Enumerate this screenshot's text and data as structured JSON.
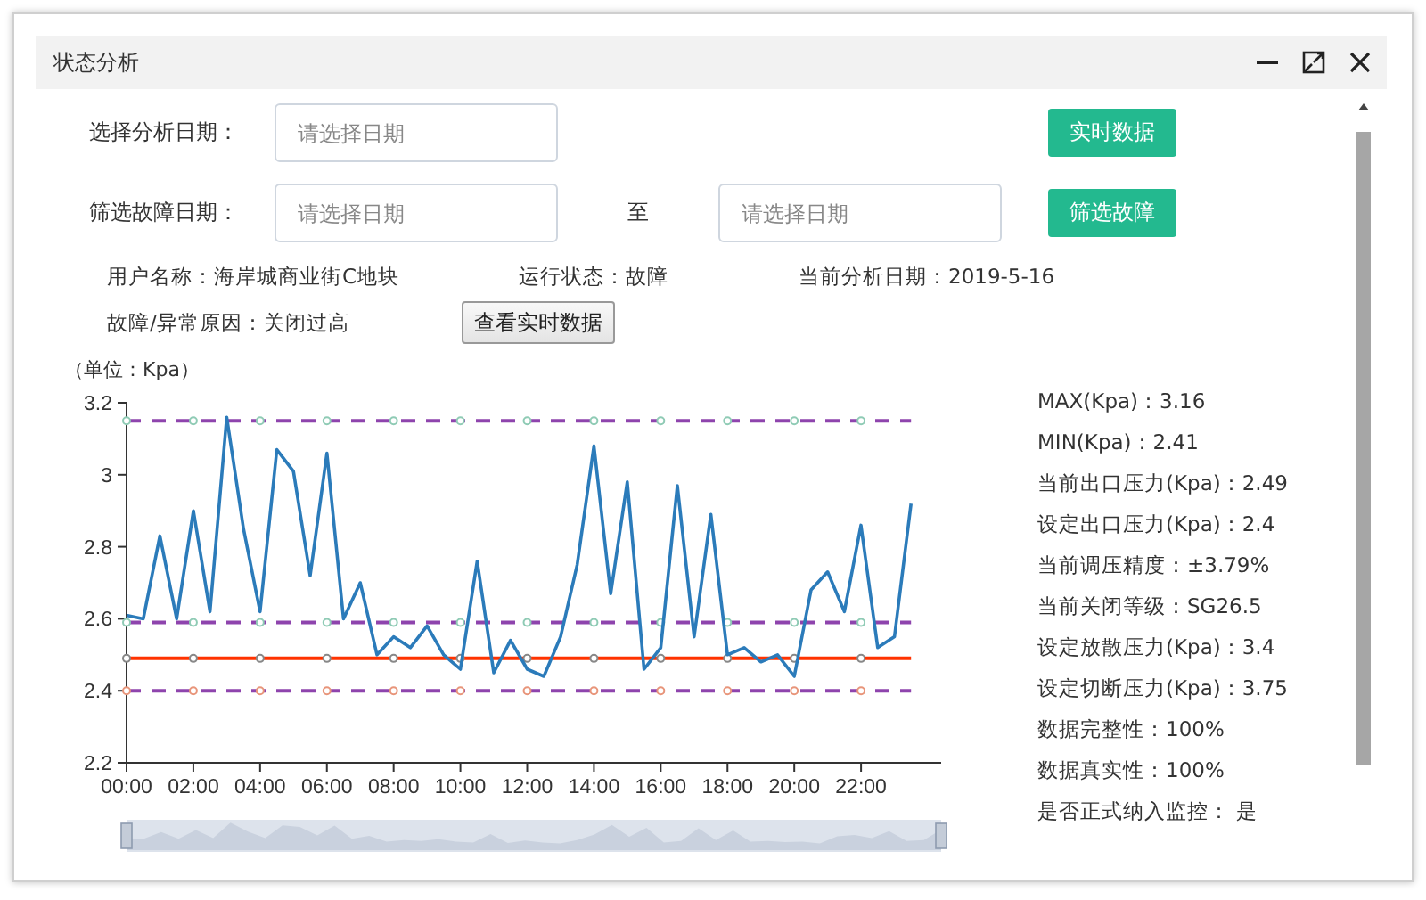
{
  "window": {
    "title": "状态分析"
  },
  "form": {
    "analysis_date": {
      "label": "选择分析日期：",
      "placeholder": "请选择日期"
    },
    "realtime_button": "实时数据",
    "fault_filter": {
      "label": "筛选故障日期：",
      "from_placeholder": "请选择日期",
      "separator": "至",
      "to_placeholder": "请选择日期"
    },
    "filter_button": "筛选故障"
  },
  "info": [
    "用户名称：海岸城商业街C地块",
    "运行状态：故障",
    "当前分析日期：2019-5-16"
  ],
  "reason": "故障/异常原因：关闭过高",
  "view_realtime_button": "查看实时数据",
  "chart": {
    "unit_label": "（单位：Kpa）",
    "chart_data": {
      "type": "line",
      "x": [
        0,
        0.5,
        1,
        1.5,
        2,
        2.5,
        3,
        3.5,
        4,
        4.5,
        5,
        5.5,
        6,
        6.5,
        7,
        7.5,
        8,
        8.5,
        9,
        9.5,
        10,
        10.5,
        11,
        11.5,
        12,
        12.5,
        13,
        13.5,
        14,
        14.5,
        15,
        15.5,
        16,
        16.5,
        17,
        17.5,
        18,
        18.5,
        19,
        19.5,
        20,
        20.5,
        21,
        21.5,
        22,
        22.5,
        23,
        23.5
      ],
      "series": [
        {
          "color": "#2b7bba",
          "values": [
            2.61,
            2.6,
            2.83,
            2.6,
            2.9,
            2.62,
            3.16,
            2.85,
            2.62,
            3.07,
            3.01,
            2.72,
            3.06,
            2.6,
            2.7,
            2.5,
            2.55,
            2.52,
            2.58,
            2.5,
            2.46,
            2.76,
            2.45,
            2.54,
            2.46,
            2.44,
            2.55,
            2.75,
            3.08,
            2.67,
            2.98,
            2.46,
            2.52,
            2.97,
            2.55,
            2.89,
            2.5,
            2.52,
            2.48,
            2.5,
            2.44,
            2.68,
            2.73,
            2.62,
            2.86,
            2.52,
            2.55,
            2.92
          ]
        },
        {
          "color": "#8e44ad",
          "line_style": "dashed",
          "values": [
            3.15,
            3.15,
            3.15,
            3.15,
            3.15,
            3.15,
            3.15,
            3.15,
            3.15,
            3.15,
            3.15,
            3.15,
            3.15,
            3.15,
            3.15,
            3.15,
            3.15,
            3.15,
            3.15,
            3.15,
            3.15,
            3.15,
            3.15,
            3.15,
            3.15,
            3.15,
            3.15,
            3.15,
            3.15,
            3.15,
            3.15,
            3.15,
            3.15,
            3.15,
            3.15,
            3.15,
            3.15,
            3.15,
            3.15,
            3.15,
            3.15,
            3.15,
            3.15,
            3.15,
            3.15,
            3.15,
            3.15,
            3.15
          ]
        },
        {
          "color": "#8e44ad",
          "line_style": "dashed",
          "values": [
            2.59,
            2.59,
            2.59,
            2.59,
            2.59,
            2.59,
            2.59,
            2.59,
            2.59,
            2.59,
            2.59,
            2.59,
            2.59,
            2.59,
            2.59,
            2.59,
            2.59,
            2.59,
            2.59,
            2.59,
            2.59,
            2.59,
            2.59,
            2.59,
            2.59,
            2.59,
            2.59,
            2.59,
            2.59,
            2.59,
            2.59,
            2.59,
            2.59,
            2.59,
            2.59,
            2.59,
            2.59,
            2.59,
            2.59,
            2.59,
            2.59,
            2.59,
            2.59,
            2.59,
            2.59,
            2.59,
            2.59,
            2.59
          ]
        },
        {
          "color": "#ff3300",
          "line_style": "solid",
          "values": [
            2.49,
            2.49,
            2.49,
            2.49,
            2.49,
            2.49,
            2.49,
            2.49,
            2.49,
            2.49,
            2.49,
            2.49,
            2.49,
            2.49,
            2.49,
            2.49,
            2.49,
            2.49,
            2.49,
            2.49,
            2.49,
            2.49,
            2.49,
            2.49,
            2.49,
            2.49,
            2.49,
            2.49,
            2.49,
            2.49,
            2.49,
            2.49,
            2.49,
            2.49,
            2.49,
            2.49,
            2.49,
            2.49,
            2.49,
            2.49,
            2.49,
            2.49,
            2.49,
            2.49,
            2.49,
            2.49,
            2.49,
            2.49
          ]
        },
        {
          "color": "#8e44ad",
          "line_style": "dashed",
          "values": [
            2.4,
            2.4,
            2.4,
            2.4,
            2.4,
            2.4,
            2.4,
            2.4,
            2.4,
            2.4,
            2.4,
            2.4,
            2.4,
            2.4,
            2.4,
            2.4,
            2.4,
            2.4,
            2.4,
            2.4,
            2.4,
            2.4,
            2.4,
            2.4,
            2.4,
            2.4,
            2.4,
            2.4,
            2.4,
            2.4,
            2.4,
            2.4,
            2.4,
            2.4,
            2.4,
            2.4,
            2.4,
            2.4,
            2.4,
            2.4,
            2.4,
            2.4,
            2.4,
            2.4,
            2.4,
            2.4,
            2.4,
            2.4
          ]
        }
      ],
      "xlim": [
        0,
        24.4
      ],
      "ylim": [
        2.2,
        3.2
      ],
      "xticks": [
        {
          "value": 0,
          "label": "00:00"
        },
        {
          "value": 2,
          "label": "02:00"
        },
        {
          "value": 4,
          "label": "04:00"
        },
        {
          "value": 6,
          "label": "06:00"
        },
        {
          "value": 8,
          "label": "08:00"
        },
        {
          "value": 10,
          "label": "10:00"
        },
        {
          "value": 12,
          "label": "12:00"
        },
        {
          "value": 14,
          "label": "14:00"
        },
        {
          "value": 16,
          "label": "16:00"
        },
        {
          "value": 18,
          "label": "18:00"
        },
        {
          "value": 20,
          "label": "20:00"
        },
        {
          "value": 22,
          "label": "22:00"
        }
      ],
      "yticks": [
        2.2,
        2.4,
        2.6,
        2.8,
        3,
        3.2
      ]
    }
  },
  "stats": [
    "MAX(Kpa)：3.16",
    "MIN(Kpa)：2.41",
    "当前出口压力(Kpa)：2.49",
    "设定出口压力(Kpa)：2.4",
    "当前调压精度：±3.79%",
    "当前关闭等级：SG26.5",
    "设定放散压力(Kpa)：3.4",
    "设定切断压力(Kpa)：3.75",
    "数据完整性：100%",
    "数据真实性：100%",
    "是否正式纳入监控： 是"
  ]
}
